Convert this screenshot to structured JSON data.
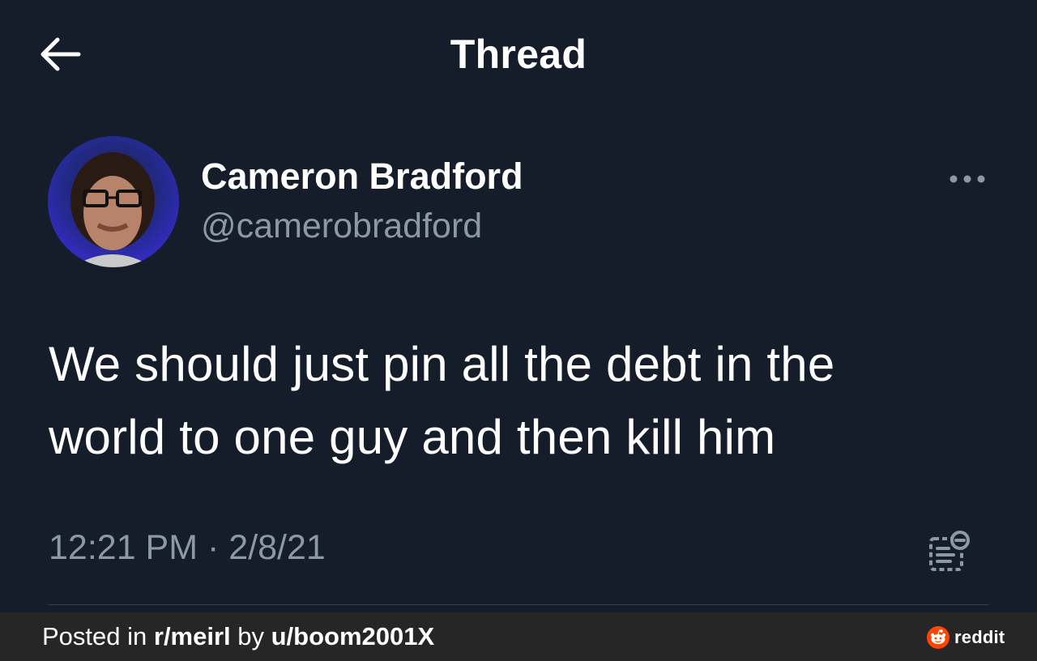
{
  "header": {
    "title": "Thread",
    "back_icon": "arrow-left-icon"
  },
  "tweet": {
    "author_name": "Cameron Bradford",
    "author_handle": "@camerobradford",
    "text_line1": "We should just pin all the debt in the",
    "text_line2": "world to one guy and then kill him",
    "time": "12:21 PM",
    "separator": " · ",
    "date": "2/8/21",
    "more_icon": "more-horizontal-icon",
    "analytics_icon": "view-activity-icon"
  },
  "footer": {
    "posted_in": "Posted in ",
    "subreddit": "r/meirl",
    "by": " by ",
    "user": "u/boom2001X",
    "brand": "reddit"
  },
  "colors": {
    "background": "#151d2a",
    "secondary_text": "#8b98a5",
    "footer_background": "#262626",
    "reddit_orange": "#ff4500"
  }
}
